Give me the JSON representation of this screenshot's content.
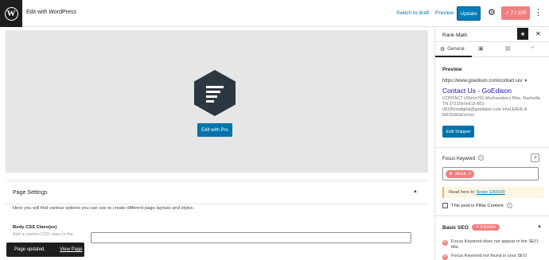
{
  "topbar": {
    "title": "Edit with WordPress",
    "switch_to_draft": "Switch to draft",
    "preview": "Preview",
    "update": "Update",
    "score": "7 / 100"
  },
  "editor": {
    "edit_with_pro": "Edit with Pro",
    "page_settings_title": "Page Settings",
    "page_settings_desc": "Here you will find various options you can use to create different page layouts and styles.",
    "body_css_label": "Body CSS Class(es)",
    "body_css_help": "Add a custom CSS class to the"
  },
  "snackbar": {
    "message": "Page updated.",
    "action": "View Page"
  },
  "sidebar": {
    "title": "Rank Math",
    "tab_general": "General",
    "preview_heading": "Preview",
    "url": "https://www.goedison.com/contact-us/",
    "page_title": "Contact Us - GoEdison",
    "description": "CONTACT US\\n\\n701 Murfreesboro Pike, Nashville, TN 37210\\n\\n615-801-0819\\n\\ndigital@goedison.com \\n\\nLEAVE A MESSAGE\\n\\n\\n",
    "edit_snippet": "Edit Snippet",
    "focus_keyword_label": "Focus Keyword",
    "keyword": "about",
    "score_note_prefix": "Read here to",
    "score_note_link": "Score 100/100",
    "pillar_label": "This post is Pillar Content",
    "basic_seo": "Basic SEO",
    "errors_badge": "6 Errors",
    "seo_items": [
      "Focus Keyword does not appear in the SEO title.",
      "Focus Keyword not found in your SEO"
    ]
  }
}
